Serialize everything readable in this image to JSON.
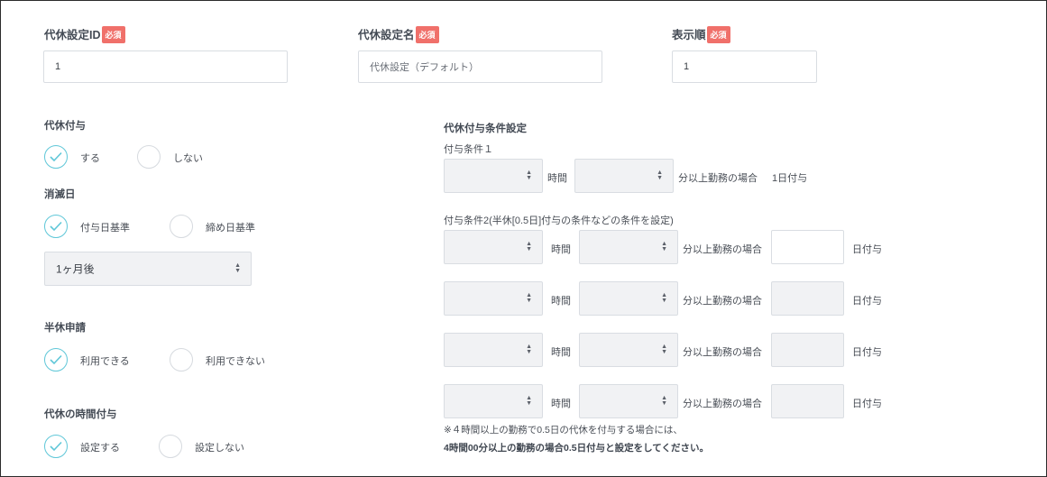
{
  "fields": {
    "id": {
      "label": "代休設定ID",
      "badge": "必須",
      "value": "1"
    },
    "name": {
      "label": "代休設定名",
      "badge": "必須",
      "value": "代休設定（デフォルト）"
    },
    "order": {
      "label": "表示順",
      "badge": "必須",
      "value": "1"
    }
  },
  "grant": {
    "label": "代休付与",
    "options": [
      "する",
      "しない"
    ],
    "selected": 0
  },
  "expiry": {
    "label": "消滅日",
    "options": [
      "付与日基準",
      "締め日基準"
    ],
    "selected": 0,
    "period": "1ヶ月後"
  },
  "half": {
    "label": "半休申請",
    "options": [
      "利用できる",
      "利用できない"
    ],
    "selected": 0
  },
  "hourly": {
    "label": "代休の時間付与",
    "options": [
      "設定する",
      "設定しない"
    ],
    "selected": 0
  },
  "conditions": {
    "title": "代休付与条件設定",
    "cond1_label": "付与条件１",
    "cond2_label": "付与条件2(半休[0.5日]付与の条件などの条件を設定)",
    "hours_unit": "時間",
    "minutes_text": "分以上勤務の場合",
    "fixed_grant": "1日付与",
    "day_unit": "日付与",
    "note_line1": "※４時間以上の勤務で0.5日の代休を付与する場合には、",
    "note_line2": "4時間00分以上の勤務の場合0.5日付与と設定をしてください。"
  }
}
